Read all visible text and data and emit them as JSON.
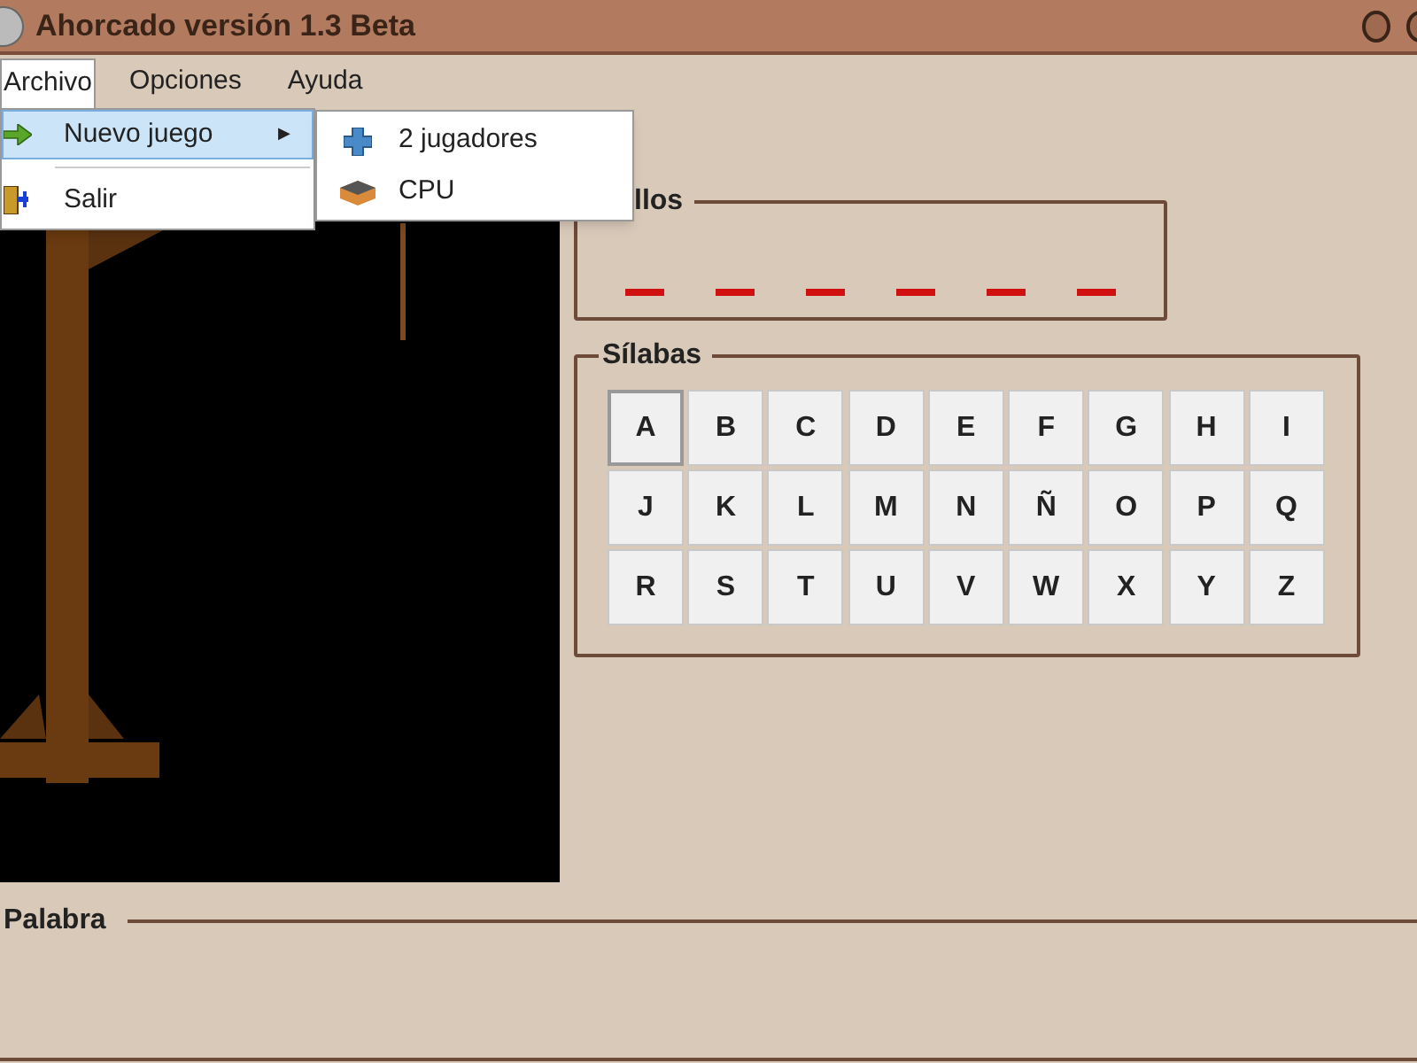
{
  "window": {
    "title": "Ahorcado versión 1.3 Beta"
  },
  "menu_bar": [
    {
      "label": "Archivo",
      "selected": true
    },
    {
      "label": "Opciones",
      "selected": false
    },
    {
      "label": "Ayuda",
      "selected": false
    }
  ],
  "archivo_menu": [
    {
      "label": "Nuevo juego",
      "submenu_arrow": "▶",
      "selected": true
    },
    {
      "label": "Salir",
      "selected": false
    }
  ],
  "nuevo_juego_submenu": [
    {
      "label": "2 jugadores"
    },
    {
      "label": "CPU"
    }
  ],
  "fallos": {
    "title": "llos",
    "slots": [
      {
        "revealed": false
      },
      {
        "revealed": false
      },
      {
        "revealed": false
      },
      {
        "revealed": false
      },
      {
        "revealed": false
      },
      {
        "revealed": false
      }
    ]
  },
  "silabas": {
    "title": "Sílabas",
    "keys": [
      {
        "label": "A",
        "focused": true
      },
      {
        "label": "B",
        "focused": false
      },
      {
        "label": "C",
        "focused": false
      },
      {
        "label": "D",
        "focused": false
      },
      {
        "label": "E",
        "focused": false
      },
      {
        "label": "F",
        "focused": false
      },
      {
        "label": "G",
        "focused": false
      },
      {
        "label": "H",
        "focused": false
      },
      {
        "label": "I",
        "focused": false
      },
      {
        "label": "J",
        "focused": false
      },
      {
        "label": "K",
        "focused": false
      },
      {
        "label": "L",
        "focused": false
      },
      {
        "label": "M",
        "focused": false
      },
      {
        "label": "N",
        "focused": false
      },
      {
        "label": "Ñ",
        "focused": false
      },
      {
        "label": "O",
        "focused": false
      },
      {
        "label": "P",
        "focused": false
      },
      {
        "label": "Q",
        "focused": false
      },
      {
        "label": "R",
        "focused": false
      },
      {
        "label": "S",
        "focused": false
      },
      {
        "label": "T",
        "focused": false
      },
      {
        "label": "U",
        "focused": false
      },
      {
        "label": "V",
        "focused": false
      },
      {
        "label": "W",
        "focused": false
      },
      {
        "label": "X",
        "focused": false
      },
      {
        "label": "Y",
        "focused": false
      },
      {
        "label": "Z",
        "focused": false
      }
    ]
  },
  "palabra": {
    "title": "Palabra"
  }
}
